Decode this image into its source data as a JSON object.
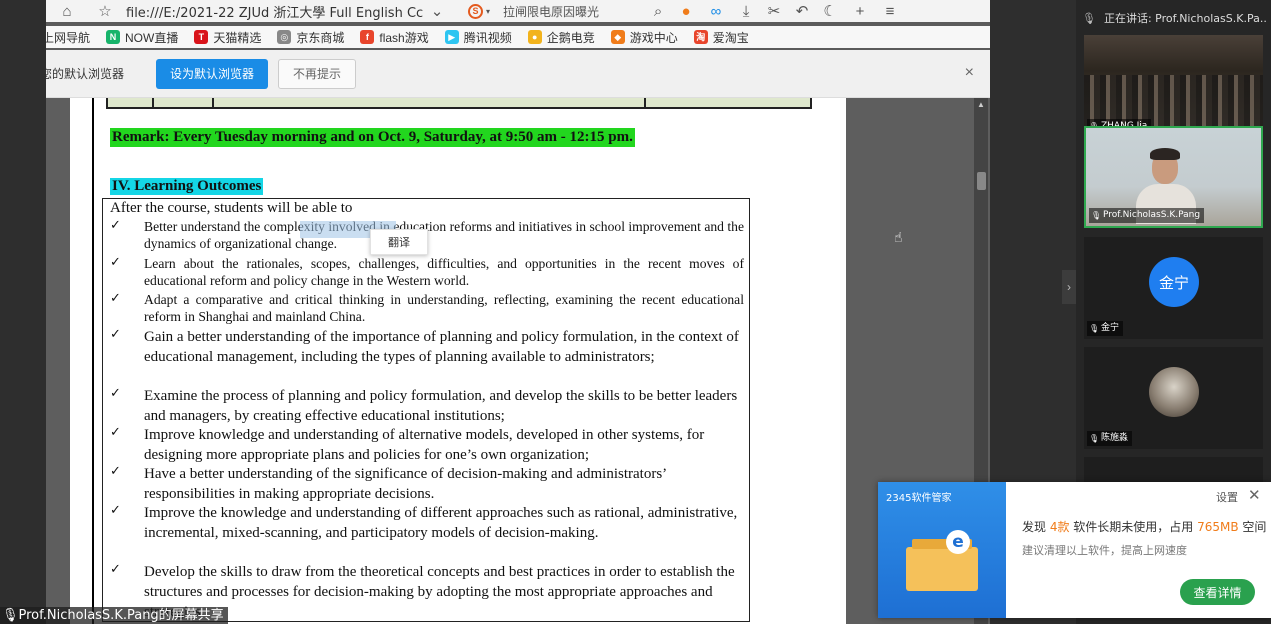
{
  "toolbar": {
    "url": "file:///E:/2021-22 ZJUd 浙江大學 Full English Cc",
    "search_suggest": "拉闸限电原因曝光",
    "s_logo": "S"
  },
  "bookmarks": [
    {
      "label": "上网导航",
      "icon": "",
      "color": "#ffffff"
    },
    {
      "label": "NOW直播",
      "icon": "N",
      "color": "#18b46b"
    },
    {
      "label": "天猫精选",
      "icon": "T",
      "color": "#d9141b"
    },
    {
      "label": "京东商城",
      "icon": "◎",
      "color": "#888888"
    },
    {
      "label": "flash游戏",
      "icon": "f",
      "color": "#e8452c"
    },
    {
      "label": "腾讯视频",
      "icon": "▶",
      "color": "#2ec5f1"
    },
    {
      "label": "企鹅电竞",
      "icon": "●",
      "color": "#f2b31c"
    },
    {
      "label": "游戏中心",
      "icon": "◆",
      "color": "#f07c1a"
    },
    {
      "label": "爱淘宝",
      "icon": "淘",
      "color": "#e8452c"
    }
  ],
  "infobar": {
    "text": "您的默认浏览器",
    "default_btn": "设为默认浏览器",
    "noprompt_btn": "不再提示",
    "close": "×"
  },
  "doc": {
    "remark": "Remark: Every Tuesday morning and on Oct. 9, Saturday, at 9:50 am - 12:15 pm.",
    "heading": "IV. Learning Outcomes",
    "intro": "After the course, students will be able to",
    "check": "✓",
    "items": [
      "Better understand the complexity involved in education reforms and initiatives in school improvement and the dynamics of organizational change.",
      "Learn about the rationales, scopes, challenges, difficulties, and opportunities in the recent moves of educational reform and policy change in the Western world.",
      "Adapt a comparative and critical thinking in understanding, reflecting, examining the recent educational reform in Shanghai and mainland China.",
      "Gain a better understanding of the importance of planning and policy formulation, in the context of educational management, including the types of planning available to administrators;",
      "Examine the process of planning and policy formulation, and develop the skills to be better leaders and managers, by creating effective educational institutions;",
      "Improve knowledge and understanding of alternative models, developed in other systems, for designing more appropriate plans and policies for one’s own organization;",
      "Have a better understanding of the significance of decision-making and administrators’ responsibilities in making appropriate decisions.",
      "Improve the knowledge and understanding of different approaches such as rational, administrative, incremental, mixed-scanning, and participatory models of decision-making.",
      "Develop the skills to draw from the theoretical concepts and best practices in order to establish the structures and processes for decision-making by adopting the most appropriate approaches and strategies."
    ],
    "translate_popup": "翻译"
  },
  "panel": {
    "speaking": "正在讲话: Prof.NicholasS.K.Pa...",
    "collapse": "›",
    "tiles": [
      {
        "name": "ZHANG Jia"
      },
      {
        "name": "Prof.NicholasS.K.Pang"
      },
      {
        "name": "金宁",
        "avatar": "金宁"
      },
      {
        "name": "陈施淼"
      },
      {
        "name": ""
      }
    ]
  },
  "notify": {
    "brand": "2345软件管家",
    "settings": "设置",
    "close": "✕",
    "line1_a": "发现 ",
    "line1_count": "4款",
    "line1_b": " 软件长期未使用，占用 ",
    "line1_size": "765MB",
    "line1_c": " 空间",
    "line2": "建议清理以上软件，提高上网速度",
    "button": "查看详情",
    "e_logo": "e"
  },
  "share_caption": "Prof.NicholasS.K.Pang的屏幕共享",
  "colors": {
    "accent": "#1a8ce6",
    "remark_bg": "#22d61e",
    "heading_bg": "#14d6e6",
    "speaker_border": "#2fa84f",
    "notify_button": "#2aa14e"
  }
}
